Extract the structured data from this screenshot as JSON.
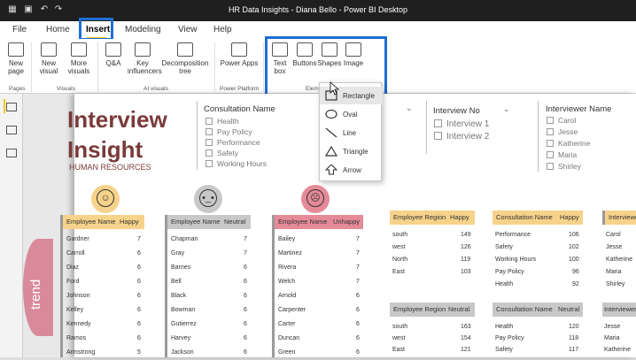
{
  "window": {
    "title": "HR Data Insights - Diana Bello - Power BI Desktop"
  },
  "menu": {
    "tabs": [
      "File",
      "Home",
      "Insert",
      "Modeling",
      "View",
      "Help"
    ]
  },
  "ribbon": {
    "buttons": {
      "new_page": "New page",
      "new_visual": "New visual",
      "more_visuals": "More visuals",
      "qa": "Q&A",
      "key_influencers": "Key influencers",
      "decomposition_tree": "Decomposition tree",
      "power_apps": "Power Apps",
      "text_box": "Text box",
      "buttons": "Buttons",
      "shapes": "Shapes",
      "image": "Image"
    },
    "groups": {
      "pages": "Pages",
      "visuals": "Visuals",
      "ai_visuals": "AI visuals",
      "power_platform": "Power Platform",
      "elements": "Elem"
    }
  },
  "shapes_menu": [
    "Rectangle",
    "Oval",
    "Line",
    "Triangle",
    "Arrow"
  ],
  "report": {
    "title_line1": "Interview",
    "title_line2": "Insight",
    "subtitle": "HUMAN RESOURCES",
    "trend_label": "trend",
    "consultation_slicer": {
      "header": "Consultation Name",
      "items": [
        "Health",
        "Pay Policy",
        "Performance",
        "Safety",
        "Working Hours"
      ]
    },
    "interview_no_slicer": {
      "header": "Interview No",
      "items": [
        "Interview 1",
        "Interview 2"
      ]
    },
    "interviewer_slicer": {
      "header": "Interviewer Name",
      "items": [
        "Carol",
        "Jesse",
        "Katherine",
        "Maria",
        "Shirley"
      ]
    },
    "happy_table": {
      "col1": "Employee Name",
      "col2": "Happy",
      "rows": [
        [
          "Gardner",
          "7"
        ],
        [
          "Carroll",
          "6"
        ],
        [
          "Diaz",
          "6"
        ],
        [
          "Ford",
          "6"
        ],
        [
          "Johnson",
          "6"
        ],
        [
          "Kelley",
          "6"
        ],
        [
          "Kennedy",
          "6"
        ],
        [
          "Ramos",
          "6"
        ],
        [
          "Armstrong",
          "5"
        ]
      ]
    },
    "neutral_table": {
      "col1": "Employee Name",
      "col2": "Neutral",
      "rows": [
        [
          "Chapman",
          "7"
        ],
        [
          "Gray",
          "7"
        ],
        [
          "Barnes",
          "6"
        ],
        [
          "Bell",
          "6"
        ],
        [
          "Black",
          "6"
        ],
        [
          "Bowman",
          "6"
        ],
        [
          "Gutierrez",
          "6"
        ],
        [
          "Harvey",
          "6"
        ],
        [
          "Jackson",
          "6"
        ]
      ]
    },
    "unhappy_table": {
      "col1": "Employee Name",
      "col2": "Unhappy",
      "rows": [
        [
          "Bailey",
          "7"
        ],
        [
          "Martinez",
          "7"
        ],
        [
          "Rivera",
          "7"
        ],
        [
          "Welch",
          "7"
        ],
        [
          "Arnold",
          "6"
        ],
        [
          "Carpenter",
          "6"
        ],
        [
          "Carter",
          "6"
        ],
        [
          "Duncan",
          "6"
        ],
        [
          "Green",
          "6"
        ]
      ]
    },
    "region_happy": {
      "col1": "Employee Region",
      "col2": "Happy",
      "rows": [
        [
          "south",
          "149"
        ],
        [
          "west",
          "126"
        ],
        [
          "North",
          "119"
        ],
        [
          "East",
          "103"
        ]
      ]
    },
    "region_neutral": {
      "col1": "Employee Region",
      "col2": "Neutral",
      "rows": [
        [
          "south",
          "163"
        ],
        [
          "west",
          "154"
        ],
        [
          "East",
          "121"
        ]
      ]
    },
    "consult_happy": {
      "col1": "Consultation Name",
      "col2": "Happy",
      "rows": [
        [
          "Performance",
          "106"
        ],
        [
          "Safety",
          "102"
        ],
        [
          "Working Hours",
          "100"
        ],
        [
          "Pay Policy",
          "96"
        ],
        [
          "Health",
          "92"
        ]
      ]
    },
    "consult_neutral": {
      "col1": "Consultation Name",
      "col2": "Neutral",
      "rows": [
        [
          "Health",
          "120"
        ],
        [
          "Pay Policy",
          "118"
        ],
        [
          "Safety",
          "117"
        ]
      ]
    },
    "interviewer_happy": {
      "col1": "Interviewe",
      "rows": [
        "Carol",
        "Jesse",
        "Katherine",
        "Maria",
        "Shirley"
      ]
    },
    "interviewer_neutral": {
      "col1": "Interviewer",
      "rows": [
        "Jesse",
        "Maria",
        "Katherine"
      ]
    }
  },
  "colors": {
    "happy": "#f6d28a",
    "neutral": "#c8c8c8",
    "unhappy": "#e58a98",
    "accent_title": "#7a3a3a",
    "highlight": "#1e6fd2"
  }
}
